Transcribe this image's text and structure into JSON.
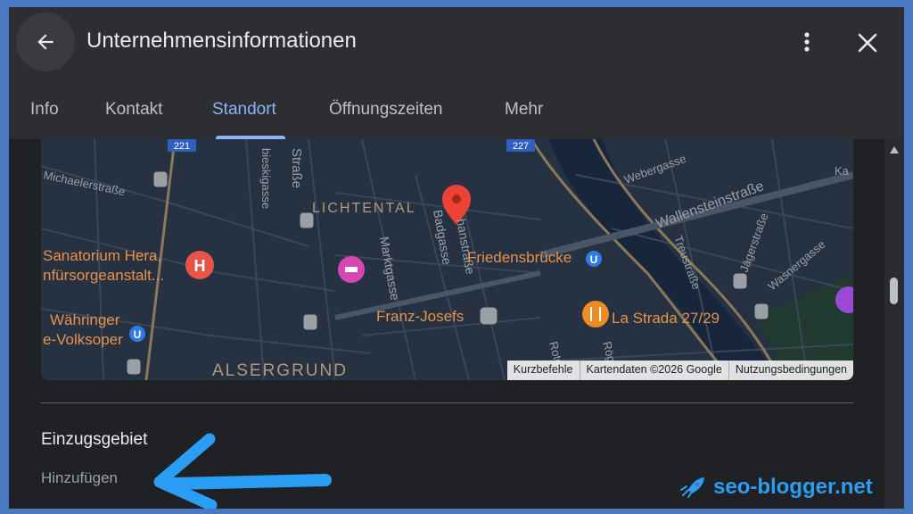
{
  "header": {
    "title": "Unternehmensinformationen",
    "icons": {
      "back": "arrow-back-icon",
      "more": "more-vert-icon",
      "close": "close-icon"
    }
  },
  "tabs": [
    {
      "label": "Info",
      "active": false
    },
    {
      "label": "Kontakt",
      "active": false
    },
    {
      "label": "Standort",
      "active": true
    },
    {
      "label": "Öffnungszeiten",
      "active": false
    },
    {
      "label": "Mehr",
      "active": false
    }
  ],
  "map": {
    "route_shields": [
      "221",
      "227"
    ],
    "labels": {
      "michaelerstrasse": "Michaelerstraße",
      "bieskigasse": "bieskigasse",
      "strasse": "Straße",
      "lichtental": "LICHTENTAL",
      "marktgasse": "Marktgasse",
      "badgasse": "Badgasse",
      "nhanstrasse": "hanstraße",
      "friedensbruecke": "Friedensbrücke",
      "webergasse": "Webergasse",
      "wallensteinstrasse": "Wallensteinstraße",
      "treustrasse": "Treustraße",
      "jaegerstrasse": "Jägerstraße",
      "wasnergasse": "Wasnergasse",
      "ka": "Ka",
      "sanatorium_line1": "Sanatorium Hera,",
      "sanatorium_line2": "nfürsorgeanstalt...",
      "waehringer_line1": "Währinger",
      "waehringer_line2": "e-Volksoper",
      "franz_josefs": "Franz-Josefs",
      "la_strada": "La Strada 27/29",
      "alsergrund": "ALSERGRUND",
      "roten": "Roten",
      "roe": "Rög"
    },
    "footer": [
      "Kurzbefehle",
      "Kartendaten ©2026 Google",
      "Nutzungsbedingungen"
    ],
    "colors": {
      "background": "#263142",
      "road": "#3b4759",
      "major_road": "#8a7a5a",
      "water": "#17263c",
      "pin": "#ea4335"
    }
  },
  "section": {
    "title": "Einzugsgebiet",
    "add_label": "Hinzufügen"
  },
  "watermark": {
    "text": "seo-blogger.net",
    "color": "#2a9df4"
  }
}
